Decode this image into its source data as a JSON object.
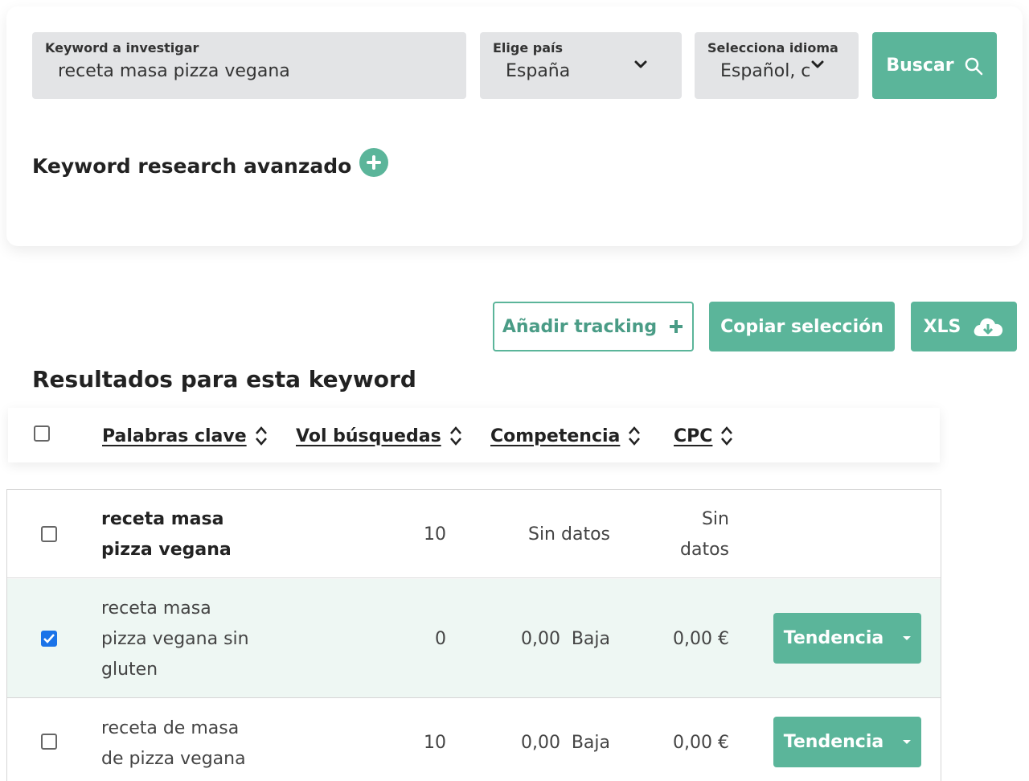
{
  "search": {
    "keyword_label": "Keyword a investigar",
    "keyword_value": "receta masa pizza vegana",
    "country_label": "Elige país",
    "country_value": "España",
    "language_label": "Selecciona idioma",
    "language_value": "Español, c",
    "search_button": "Buscar"
  },
  "advanced": {
    "label": "Keyword research avanzado"
  },
  "actions": {
    "add_tracking": "Añadir tracking",
    "copy_selection": "Copiar selección",
    "xls": "XLS"
  },
  "results": {
    "title": "Resultados para esta keyword",
    "columns": [
      "Palabras clave",
      "Vol búsquedas",
      "Competencia",
      "CPC"
    ],
    "rows": [
      {
        "keyword_lines": [
          "receta masa",
          "pizza vegana"
        ],
        "volume": "10",
        "competition_value": "",
        "competition_level": "Sin datos",
        "cpc_lines": [
          "Sin",
          "datos"
        ],
        "checked": false,
        "trend_button": ""
      },
      {
        "keyword_lines": [
          "receta masa",
          "pizza vegana sin",
          "gluten"
        ],
        "volume": "0",
        "competition_value": "0,00",
        "competition_level": "Baja",
        "cpc_lines": [
          "0,00 €"
        ],
        "checked": true,
        "trend_button": "Tendencia"
      },
      {
        "keyword_lines": [
          "receta de masa",
          "de pizza vegana"
        ],
        "volume": "10",
        "competition_value": "0,00",
        "competition_level": "Baja",
        "cpc_lines": [
          "0,00 €"
        ],
        "checked": false,
        "trend_button": "Tendencia"
      }
    ]
  },
  "colors": {
    "accent": "#5bb59a",
    "field_bg": "#e3e4e6",
    "selected_row_bg": "#eef7f3",
    "checkbox_checked": "#1a73e8"
  },
  "icons": {
    "search": "search-icon",
    "dropdown": "chevron-down-icon",
    "add_circle": "plus-circle-icon",
    "plus": "plus-icon",
    "download": "cloud-download-icon",
    "sort": "sort-icon",
    "caret": "caret-down-icon"
  }
}
